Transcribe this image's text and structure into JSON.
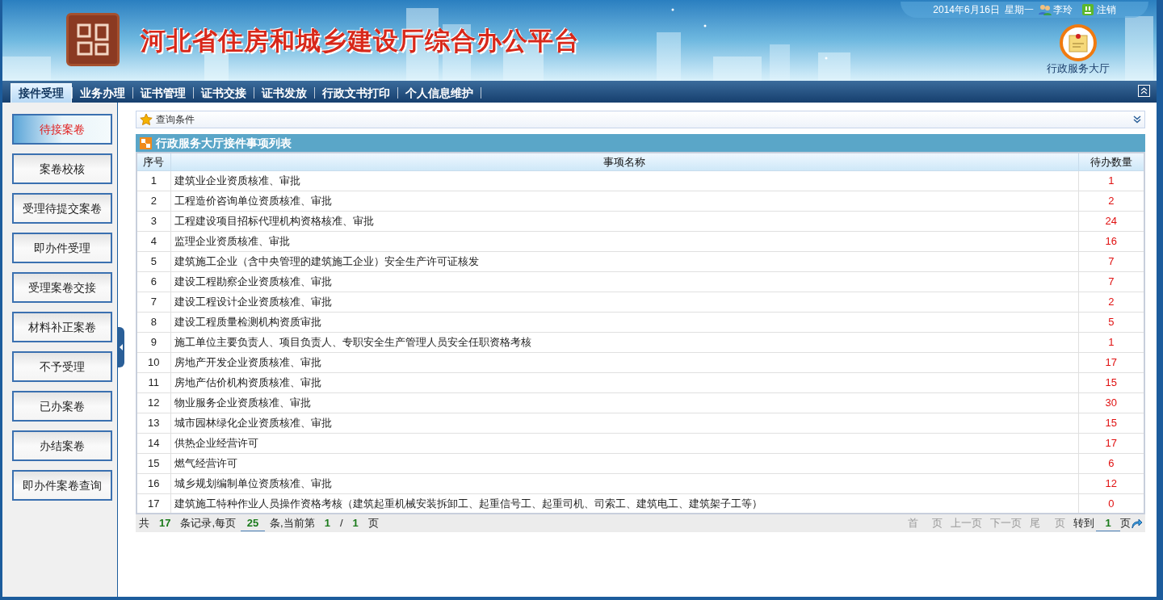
{
  "header": {
    "title": "河北省住房和城乡建设厅综合办公平台",
    "date": "2014年6月16日",
    "weekday": "星期一",
    "user": "李玲",
    "logout": "注销",
    "hall": "行政服务大厅"
  },
  "nav": [
    {
      "label": "接件受理",
      "selected": true
    },
    {
      "label": "业务办理",
      "selected": false
    },
    {
      "label": "证书管理",
      "selected": false
    },
    {
      "label": "证书交接",
      "selected": false
    },
    {
      "label": "证书发放",
      "selected": false
    },
    {
      "label": "行政文书打印",
      "selected": false
    },
    {
      "label": "个人信息维护",
      "selected": false
    }
  ],
  "sidebar": [
    {
      "label": "待接案卷",
      "selected": true
    },
    {
      "label": "案卷校核",
      "selected": false
    },
    {
      "label": "受理待提交案卷",
      "selected": false
    },
    {
      "label": "即办件受理",
      "selected": false
    },
    {
      "label": "受理案卷交接",
      "selected": false
    },
    {
      "label": "材料补正案卷",
      "selected": false
    },
    {
      "label": "不予受理",
      "selected": false
    },
    {
      "label": "已办案卷",
      "selected": false
    },
    {
      "label": "办结案卷",
      "selected": false
    },
    {
      "label": "即办件案卷查询",
      "selected": false
    }
  ],
  "query_panel": {
    "title": "查询条件"
  },
  "table": {
    "title": "行政服务大厅接件事项列表",
    "columns": [
      "序号",
      "事项名称",
      "待办数量"
    ],
    "rows": [
      {
        "no": "1",
        "name": "建筑业企业资质核准、审批",
        "count": "1"
      },
      {
        "no": "2",
        "name": "工程造价咨询单位资质核准、审批",
        "count": "2"
      },
      {
        "no": "3",
        "name": "工程建设项目招标代理机构资格核准、审批",
        "count": "24"
      },
      {
        "no": "4",
        "name": "监理企业资质核准、审批",
        "count": "16"
      },
      {
        "no": "5",
        "name": "建筑施工企业（含中央管理的建筑施工企业）安全生产许可证核发",
        "count": "7"
      },
      {
        "no": "6",
        "name": "建设工程勘察企业资质核准、审批",
        "count": "7"
      },
      {
        "no": "7",
        "name": "建设工程设计企业资质核准、审批",
        "count": "2"
      },
      {
        "no": "8",
        "name": "建设工程质量检测机构资质审批",
        "count": "5"
      },
      {
        "no": "9",
        "name": "施工单位主要负责人、项目负责人、专职安全生产管理人员安全任职资格考核",
        "count": "1"
      },
      {
        "no": "10",
        "name": "房地产开发企业资质核准、审批",
        "count": "17"
      },
      {
        "no": "11",
        "name": "房地产估价机构资质核准、审批",
        "count": "15"
      },
      {
        "no": "12",
        "name": "物业服务企业资质核准、审批",
        "count": "30"
      },
      {
        "no": "13",
        "name": "城市园林绿化企业资质核准、审批",
        "count": "15"
      },
      {
        "no": "14",
        "name": "供热企业经营许可",
        "count": "17"
      },
      {
        "no": "15",
        "name": "燃气经营许可",
        "count": "6"
      },
      {
        "no": "16",
        "name": "城乡规划编制单位资质核准、审批",
        "count": "12"
      },
      {
        "no": "17",
        "name": "建筑施工特种作业人员操作资格考核（建筑起重机械安装拆卸工、起重信号工、起重司机、司索工、建筑电工、建筑架子工等）",
        "count": "0"
      }
    ]
  },
  "pagination": {
    "total_prefix": "共",
    "total": "17",
    "per_page_label": "条记录,每页",
    "per_page": "25",
    "current_label": "条,当前第",
    "current": "1",
    "slash": "/",
    "pages": "1",
    "pages_suffix": "页",
    "links": [
      "首 页",
      "上一页",
      "下一页",
      "尾 页"
    ],
    "goto_label": "转到",
    "goto_value": "1",
    "goto_suffix": "页"
  }
}
